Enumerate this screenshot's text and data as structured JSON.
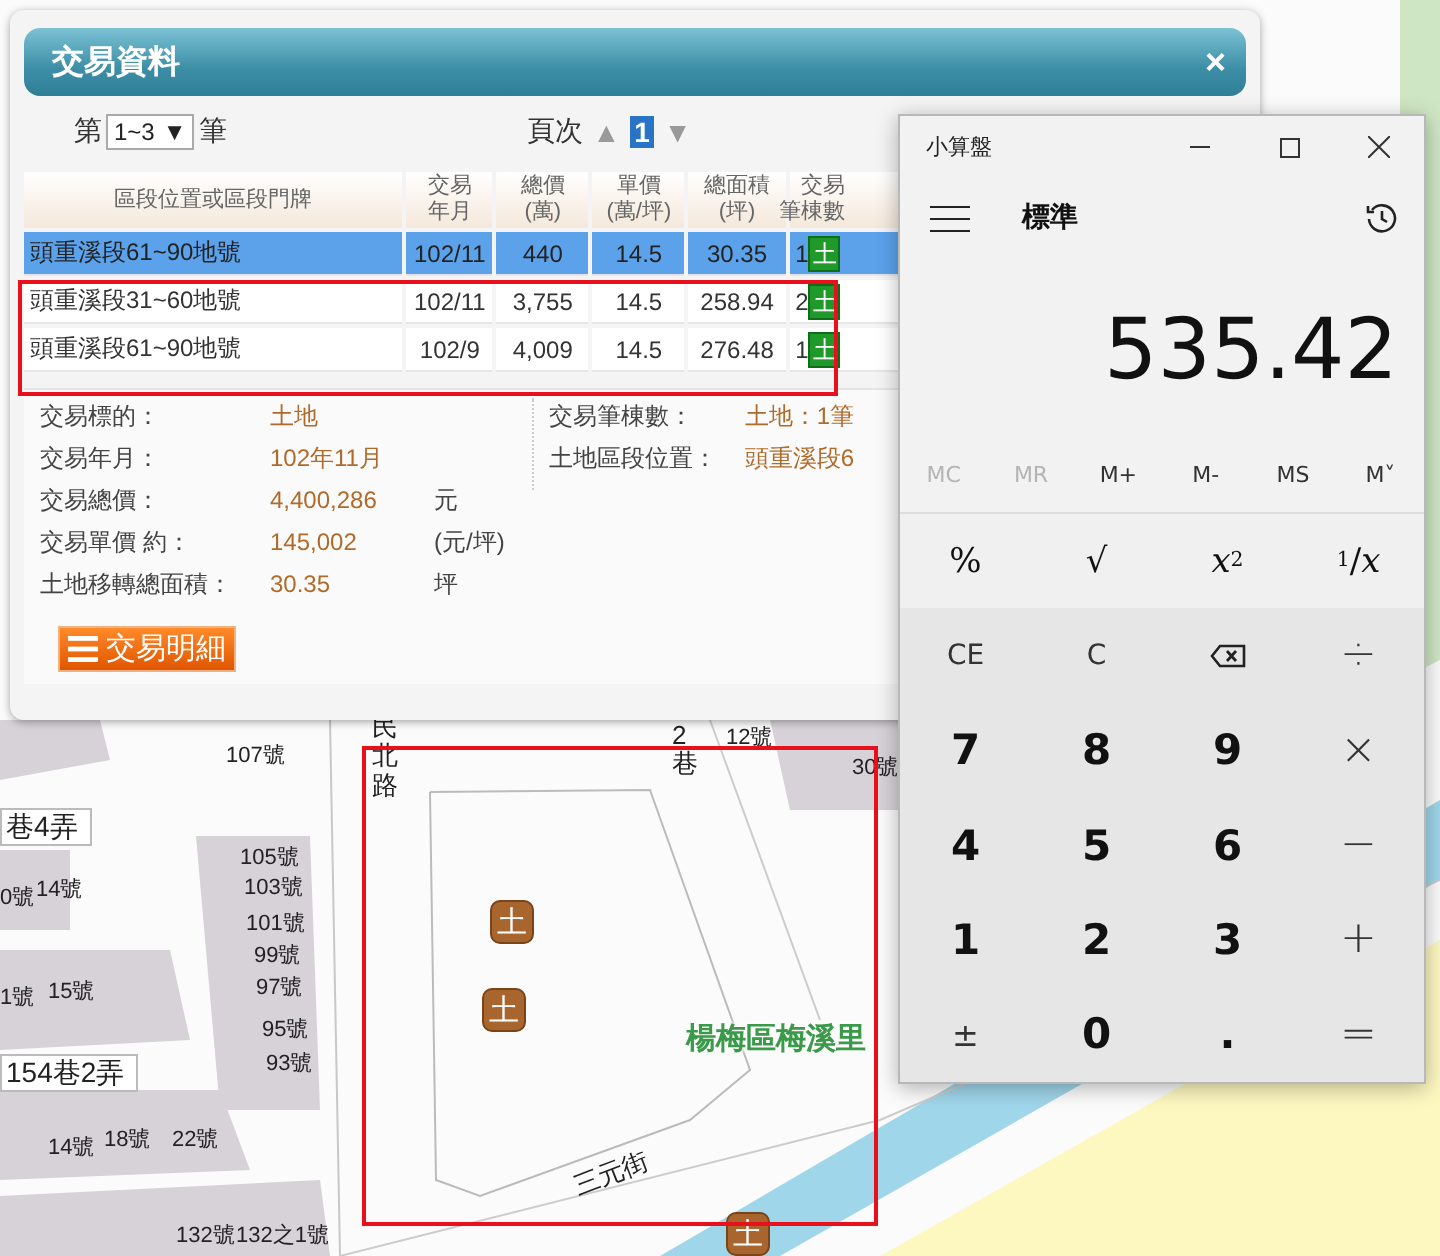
{
  "map": {
    "labels": [
      {
        "text": "107號",
        "kind": "house"
      },
      {
        "text": "巷4弄",
        "kind": "lane"
      },
      {
        "text": "105號",
        "kind": "house"
      },
      {
        "text": "103號",
        "kind": "house"
      },
      {
        "text": "101號",
        "kind": "house"
      },
      {
        "text": "99號",
        "kind": "house"
      },
      {
        "text": "97號",
        "kind": "house"
      },
      {
        "text": "95號",
        "kind": "house"
      },
      {
        "text": "93號",
        "kind": "house"
      },
      {
        "text": "0號",
        "kind": "house"
      },
      {
        "text": "14號",
        "kind": "house"
      },
      {
        "text": "1號",
        "kind": "house"
      },
      {
        "text": "15號",
        "kind": "house"
      },
      {
        "text": "154巷2弄",
        "kind": "lane"
      },
      {
        "text": "14號",
        "kind": "house"
      },
      {
        "text": "18號",
        "kind": "house"
      },
      {
        "text": "22號",
        "kind": "house"
      },
      {
        "text": "132號",
        "kind": "house"
      },
      {
        "text": "132之1號",
        "kind": "house"
      },
      {
        "text": "民北路",
        "kind": "road"
      },
      {
        "text": "2巷",
        "kind": "road"
      },
      {
        "text": "12號",
        "kind": "house"
      },
      {
        "text": "30號",
        "kind": "house"
      },
      {
        "text": "楊梅區梅溪里",
        "kind": "district"
      },
      {
        "text": "三元街",
        "kind": "street"
      }
    ],
    "markers": [
      {
        "label": "土"
      },
      {
        "label": "土"
      },
      {
        "label": "土"
      }
    ]
  },
  "dialog": {
    "title": "交易資料",
    "close": "×",
    "range": {
      "prefix": "第",
      "value": "1~3",
      "arrow": "▼",
      "suffix": "筆"
    },
    "pager": {
      "label": "頁次",
      "prev": "▲",
      "next": "▼",
      "pages": [
        {
          "label": "1",
          "selected": true
        }
      ]
    },
    "table": {
      "columns": [
        "區段位置或區段門牌",
        "交易年月",
        "總價(萬)",
        "單價(萬/坪)",
        "總面積(坪)",
        "交易筆棟數"
      ],
      "rows": [
        {
          "cells": [
            "頭重溪段61~90地號",
            "102/11",
            "440",
            "14.5",
            "30.35",
            "1"
          ],
          "badge": "土",
          "selected": true
        },
        {
          "cells": [
            "頭重溪段31~60地號",
            "102/11",
            "3,755",
            "14.5",
            "258.94",
            "2"
          ],
          "badge": "土",
          "selected": false
        },
        {
          "cells": [
            "頭重溪段61~90地號",
            "102/9",
            "4,009",
            "14.5",
            "276.48",
            "1"
          ],
          "badge": "土",
          "selected": false
        }
      ]
    },
    "details": {
      "left": [
        {
          "label": "交易標的：",
          "value": "土地"
        },
        {
          "label": "交易年月：",
          "value": "102年11月"
        },
        {
          "label": "交易總價：",
          "value": "4,400,286",
          "unit": "元"
        },
        {
          "label": "交易單價 約：",
          "value": "145,002",
          "unit": "(元/坪)"
        },
        {
          "label": "土地移轉總面積：",
          "value": "30.35",
          "unit": "坪"
        }
      ],
      "right": [
        {
          "label": "交易筆棟數：",
          "value": "土地：1筆"
        },
        {
          "label": "土地區段位置：",
          "value": "頭重溪段6"
        }
      ]
    },
    "button": "交易明細"
  },
  "calculator": {
    "title": "小算盤",
    "mode": "標準",
    "display": "535.42",
    "memory_buttons": [
      {
        "label": "MC",
        "disabled": true
      },
      {
        "label": "MR",
        "disabled": true
      },
      {
        "label": "M+",
        "disabled": false
      },
      {
        "label": "M-",
        "disabled": false
      },
      {
        "label": "MS",
        "disabled": false
      },
      {
        "label": "M˅",
        "disabled": false
      }
    ],
    "keys": [
      {
        "label": "%",
        "kind": "function"
      },
      {
        "label": "√",
        "kind": "function"
      },
      {
        "label": "*x*$^{2}$",
        "kind": "function"
      },
      {
        "label": "$^{1}$/*x*",
        "kind": "function"
      },
      {
        "label": "CE",
        "kind": "clear"
      },
      {
        "label": "C",
        "kind": "clear"
      },
      {
        "kind": "backspace"
      },
      {
        "label": "÷",
        "kind": "operator"
      },
      {
        "label": "7",
        "kind": "digit"
      },
      {
        "label": "8",
        "kind": "digit"
      },
      {
        "label": "9",
        "kind": "digit"
      },
      {
        "label": "×",
        "kind": "operator"
      },
      {
        "label": "4",
        "kind": "digit"
      },
      {
        "label": "5",
        "kind": "digit"
      },
      {
        "label": "6",
        "kind": "digit"
      },
      {
        "label": "−",
        "kind": "operator"
      },
      {
        "label": "1",
        "kind": "digit"
      },
      {
        "label": "2",
        "kind": "digit"
      },
      {
        "label": "3",
        "kind": "digit"
      },
      {
        "label": "+",
        "kind": "operator"
      },
      {
        "label": "±",
        "kind": "sign"
      },
      {
        "label": "0",
        "kind": "digit"
      },
      {
        "label": ".",
        "kind": "digit"
      },
      {
        "label": "=",
        "kind": "operator"
      }
    ]
  }
}
